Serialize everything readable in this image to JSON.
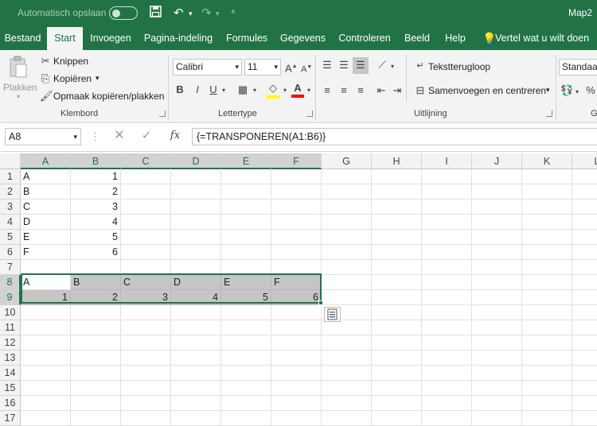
{
  "titlebar": {
    "autosave_label": "Automatisch opslaan",
    "doc_title": "Map2"
  },
  "tabs": [
    {
      "label": "Bestand"
    },
    {
      "label": "Start",
      "active": true
    },
    {
      "label": "Invoegen"
    },
    {
      "label": "Pagina-indeling"
    },
    {
      "label": "Formules"
    },
    {
      "label": "Gegevens"
    },
    {
      "label": "Controleren"
    },
    {
      "label": "Beeld"
    },
    {
      "label": "Help"
    }
  ],
  "tell_me": "Vertel wat u wilt doen",
  "clipboard": {
    "paste": "Plakken",
    "cut": "Knippen",
    "copy": "Kopiëren",
    "format_painter": "Opmaak kopiëren/plakken",
    "group": "Klembord"
  },
  "font": {
    "name": "Calibri",
    "size": "11",
    "group": "Lettertype",
    "bold": "B",
    "italic": "I",
    "underline": "U"
  },
  "alignment": {
    "wrap": "Tekstterugloop",
    "merge": "Samenvoegen en centreren",
    "group": "Uitlijning"
  },
  "number": {
    "format": "Standaard",
    "percent": "%",
    "group": "G"
  },
  "formula_bar": {
    "name_box": "A8",
    "formula": "{=TRANSPONEREN(A1:B6)}",
    "fx": "fx"
  },
  "columns": [
    "A",
    "B",
    "C",
    "D",
    "E",
    "F",
    "G",
    "H",
    "I",
    "J",
    "K",
    "L"
  ],
  "rows": [
    "1",
    "2",
    "3",
    "4",
    "5",
    "6",
    "7",
    "8",
    "9",
    "10",
    "11",
    "12",
    "13",
    "14",
    "15",
    "16",
    "17"
  ],
  "cells": {
    "A1": "A",
    "B1": "1",
    "A2": "B",
    "B2": "2",
    "A3": "C",
    "B3": "3",
    "A4": "D",
    "B4": "4",
    "A5": "E",
    "B5": "5",
    "A6": "F",
    "B6": "6",
    "A8": "A",
    "B8": "B",
    "C8": "C",
    "D8": "D",
    "E8": "E",
    "F8": "F",
    "A9": "1",
    "B9": "2",
    "C9": "3",
    "D9": "4",
    "E9": "5",
    "F9": "6"
  },
  "colors": {
    "excel_green": "#217346",
    "selection_gray": "#c6c6c6"
  }
}
